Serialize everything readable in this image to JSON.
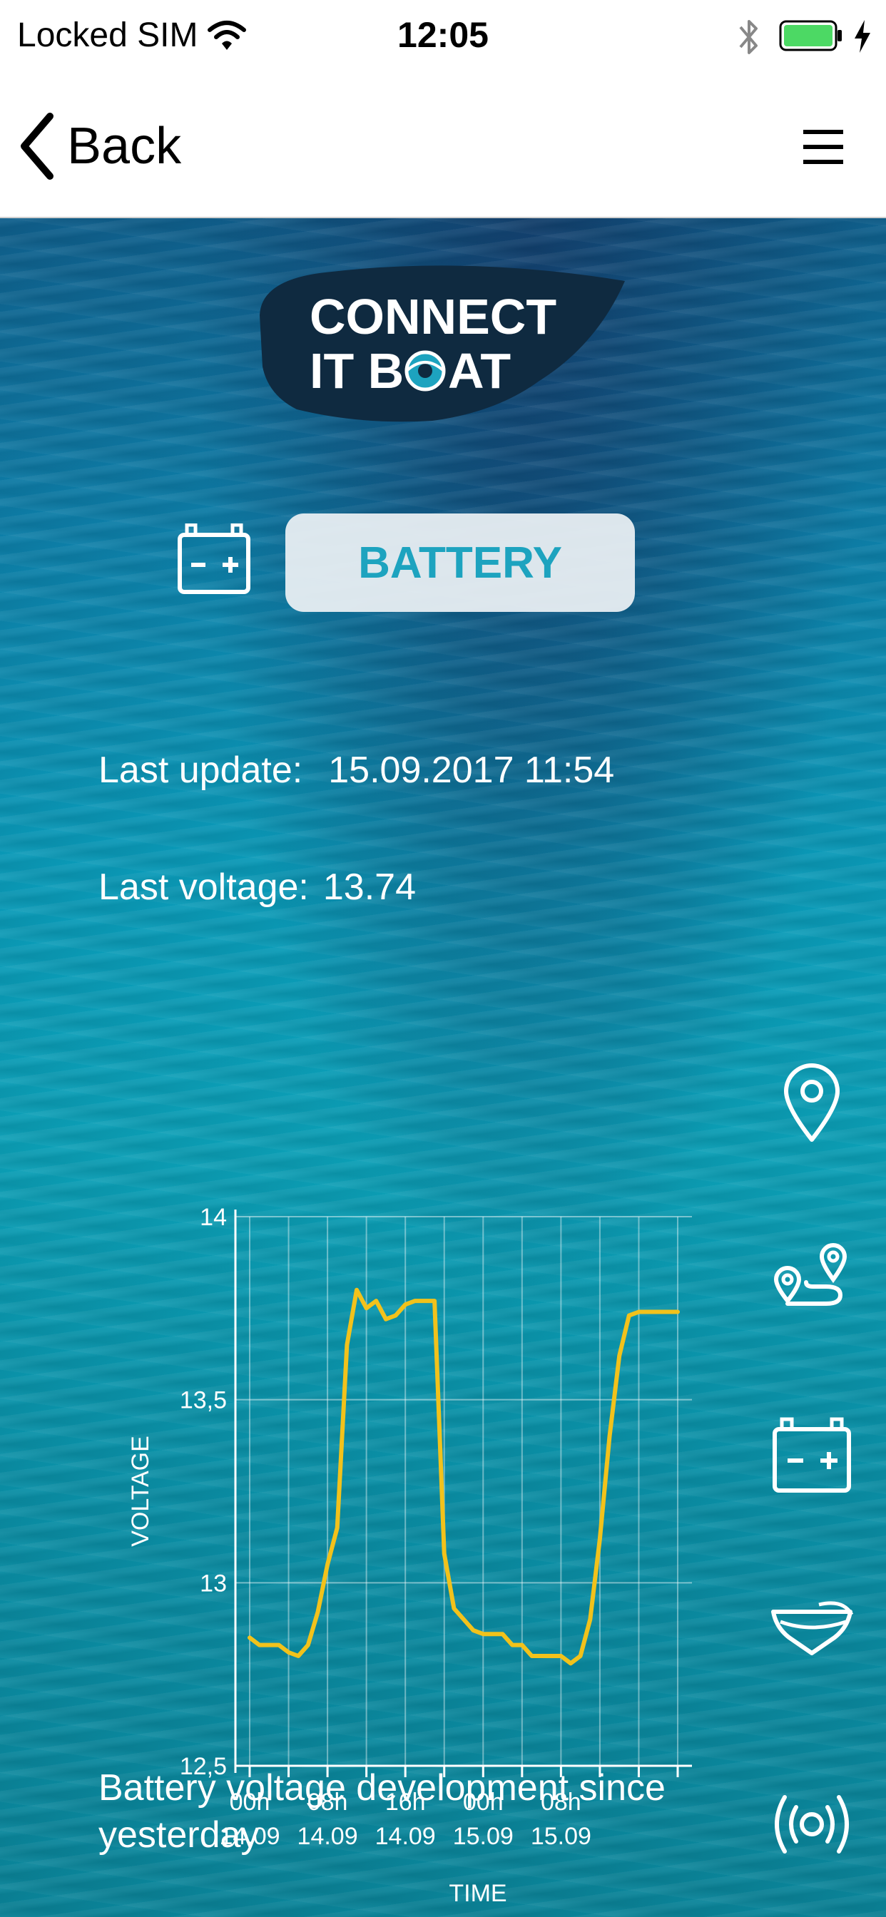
{
  "status_bar": {
    "carrier": "Locked SIM",
    "time": "12:05"
  },
  "nav": {
    "back_label": "Back"
  },
  "logo": {
    "line1": "CONNECT",
    "line2_a": "IT B",
    "line2_b": "AT"
  },
  "page": {
    "title": "BATTERY",
    "last_update_label": "Last update:",
    "last_update_value": "15.09.2017 11:54",
    "last_voltage_label": "Last voltage:",
    "last_voltage_value": "13.74",
    "caption": "Battery voltage development since yesterday"
  },
  "side_menu": [
    {
      "name": "location-pin-icon"
    },
    {
      "name": "route-icon"
    },
    {
      "name": "battery-icon"
    },
    {
      "name": "boat-hull-icon"
    },
    {
      "name": "signal-icon"
    }
  ],
  "colors": {
    "line": "#f2c21b",
    "accent": "#1da3bf",
    "logo_bg": "#0f2a40"
  },
  "chart_data": {
    "type": "line",
    "title": "",
    "xlabel": "TIME",
    "ylabel": "VOLTAGE",
    "ylim": [
      12.5,
      14
    ],
    "yticks": [
      "14",
      "13,5",
      "13",
      "12,5"
    ],
    "xtick_labels": [
      {
        "top": "00h",
        "bottom": "14.09"
      },
      {
        "top": "08h",
        "bottom": "14.09"
      },
      {
        "top": "16h",
        "bottom": "14.09"
      },
      {
        "top": "00h",
        "bottom": "15.09"
      },
      {
        "top": "08h",
        "bottom": "15.09"
      }
    ],
    "x_range_hours": [
      0,
      44
    ],
    "grid": true,
    "series": [
      {
        "x": [
          0,
          1,
          2,
          3,
          4,
          5,
          6,
          7,
          8,
          9,
          10,
          11,
          12,
          13,
          14,
          15,
          16,
          17,
          18,
          19,
          20,
          21,
          22,
          23,
          24,
          25,
          26,
          27,
          28,
          29,
          30,
          31,
          32,
          33,
          34,
          35,
          36,
          37,
          38,
          39,
          40,
          41,
          42,
          43,
          44
        ],
        "y": [
          12.85,
          12.83,
          12.83,
          12.83,
          12.81,
          12.8,
          12.83,
          12.92,
          13.05,
          13.15,
          13.65,
          13.8,
          13.75,
          13.77,
          13.72,
          13.73,
          13.76,
          13.77,
          13.77,
          13.77,
          13.08,
          12.93,
          12.9,
          12.87,
          12.86,
          12.86,
          12.86,
          12.83,
          12.83,
          12.8,
          12.8,
          12.8,
          12.8,
          12.78,
          12.8,
          12.9,
          13.12,
          13.4,
          13.62,
          13.73,
          13.74,
          13.74,
          13.74,
          13.74,
          13.74
        ]
      }
    ]
  }
}
